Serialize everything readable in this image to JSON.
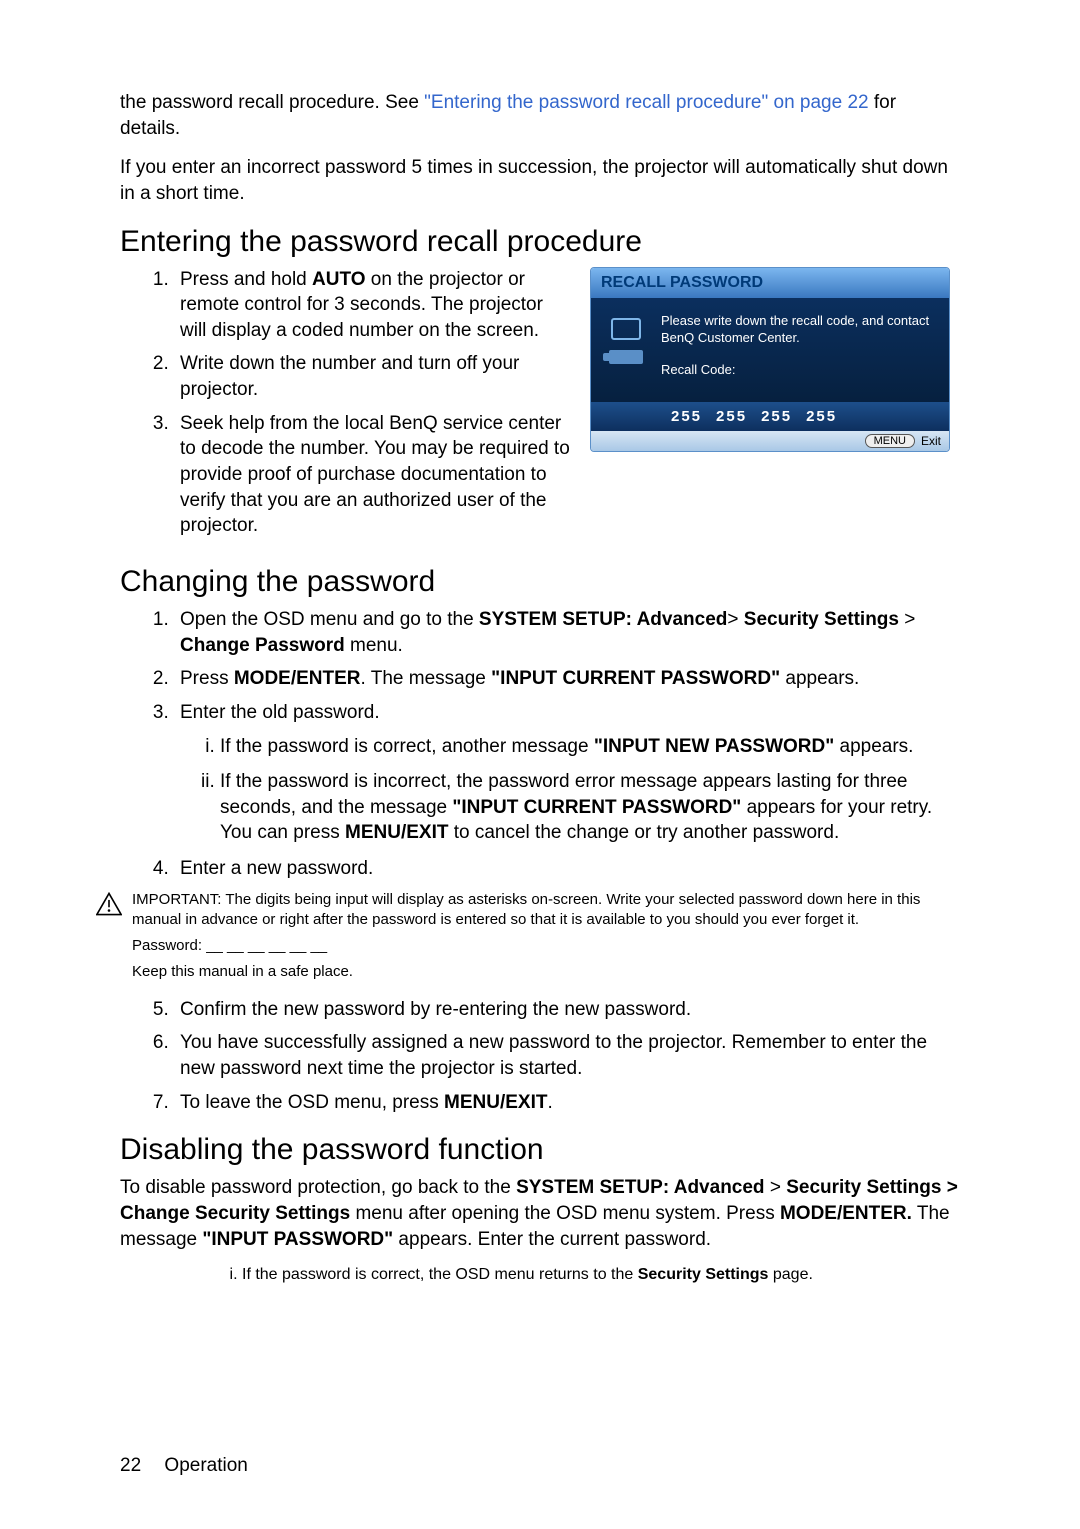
{
  "intro": {
    "pre_link": "the password recall procedure. See ",
    "link": "\"Entering the password recall procedure\" on page 22",
    "post_link": " for details.",
    "incorrect5": "If you enter an incorrect password 5 times in succession, the projector will automatically shut down in a short time."
  },
  "section1": {
    "heading": "Entering the password recall procedure",
    "items": [
      "Press and hold <b>AUTO</b> on the projector or remote control for 3 seconds. The projector will display a coded number on the screen.",
      "Write down the number and turn off your projector.",
      "Seek help from the local BenQ service center to decode the number. You may be required to provide proof of purchase documentation to verify that you are an authorized user of the projector."
    ]
  },
  "osd": {
    "title": "RECALL PASSWORD",
    "msg": "Please write down the recall code, and contact BenQ Customer Center.",
    "recall_label": "Recall Code:",
    "codes": [
      "255",
      "255",
      "255",
      "255"
    ],
    "menu_btn": "MENU",
    "exit": "Exit"
  },
  "section2": {
    "heading": "Changing the password",
    "item1": "Open the OSD menu and go to the <b>SYSTEM SETUP: Advanced</b>> <b>Security Settings</b> > <b>Change Password</b> menu.",
    "item2": "Press <b>MODE/ENTER</b>. The message <b>\"INPUT CURRENT PASSWORD\"</b> appears.",
    "item3": "Enter the old password.",
    "item3_i": "If the password is correct, another message <b>\"INPUT NEW PASSWORD\"</b> appears.",
    "item3_ii": "If the password is incorrect, the password error message appears lasting for three seconds, and the message <b>\"INPUT CURRENT PASSWORD\"</b> appears for your retry. You can press <b>MENU/EXIT</b> to cancel the change or try another password.",
    "item4": "Enter a new password.",
    "important": "IMPORTANT: The digits being input will display as asterisks on-screen. Write your selected password down here in this manual in advance or right after the password is entered so that it is available to you should you ever forget it.",
    "pw_line": "Password: __ __ __ __ __ __",
    "safe": "Keep this manual in a safe place.",
    "item5": "Confirm the new password by re-entering the new password.",
    "item6": "You have successfully assigned a new password to the projector. Remember to enter the new password next time the projector is started.",
    "item7": "To leave the OSD menu, press <b>MENU/EXIT</b>."
  },
  "section3": {
    "heading": "Disabling the password function",
    "para": "To disable password protection, go back to the <b>SYSTEM SETUP: Advanced</b> > <b>Security Settings > Change Security Settings</b> menu after opening the OSD menu system. Press <b>MODE/ENTER.</b> The message <b>\"INPUT PASSWORD\"</b> appears. Enter the current password.",
    "sub_i": "If the password is correct, the OSD menu returns to the <b>Security Settings</b> page."
  },
  "footer": {
    "page": "22",
    "section": "Operation"
  }
}
